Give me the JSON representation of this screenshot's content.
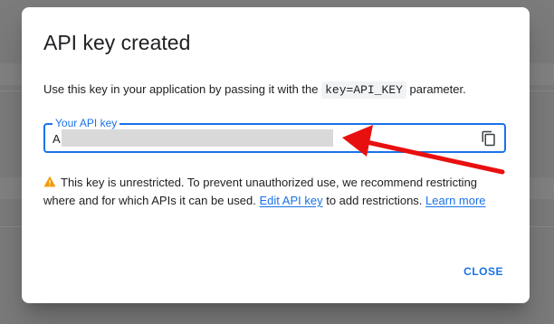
{
  "dialog": {
    "title": "API key created",
    "intro_before": "Use this key in your application by passing it with the ",
    "intro_code": "key=API_KEY",
    "intro_after": " parameter.",
    "field_label": "Your API key",
    "field_value": "A",
    "copy_icon": "copy-icon",
    "warning_icon": "warning-icon",
    "warning_text": "This key is unrestricted. To prevent unauthorized use, we recommend restricting where and for which APIs it can be used.",
    "edit_link": "Edit API key",
    "warning_middle": "to add restrictions.",
    "learn_more": "Learn more",
    "close_label": "CLOSE"
  },
  "annotation": {
    "arrow_color": "#e8100f"
  },
  "colors": {
    "accent": "#1a73e8",
    "warning": "#f29900"
  }
}
